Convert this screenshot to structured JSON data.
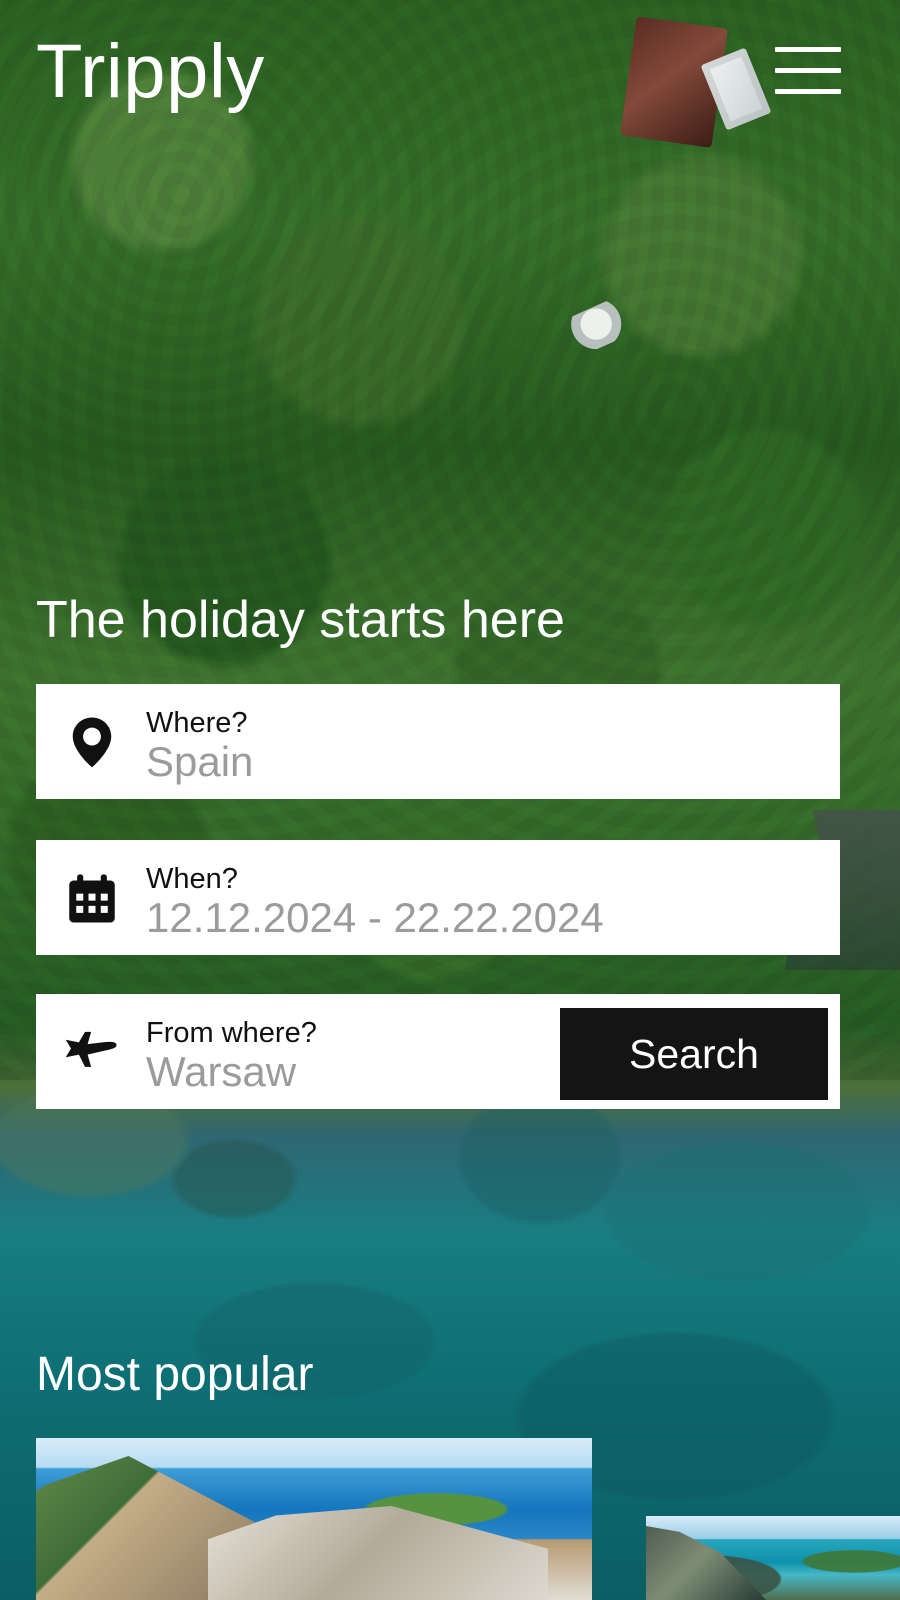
{
  "app": {
    "title": "Tripply"
  },
  "header": {
    "menu_icon": "hamburger-menu-icon"
  },
  "hero": {
    "title": "The holiday starts here"
  },
  "search": {
    "where": {
      "label": "Where?",
      "value": "Spain",
      "icon": "location-pin-icon"
    },
    "when": {
      "label": "When?",
      "value": "12.12.2024 - 22.22.2024",
      "icon": "calendar-icon"
    },
    "from": {
      "label": "From where?",
      "value": "Warsaw",
      "icon": "airplane-icon"
    },
    "button_label": "Search"
  },
  "popular": {
    "title": "Most popular"
  },
  "colors": {
    "white": "#ffffff",
    "dark_button": "#141414",
    "placeholder_gray": "#9b9b9b",
    "forest_green": "#3f7a31",
    "sea_teal": "#0e6f74"
  }
}
